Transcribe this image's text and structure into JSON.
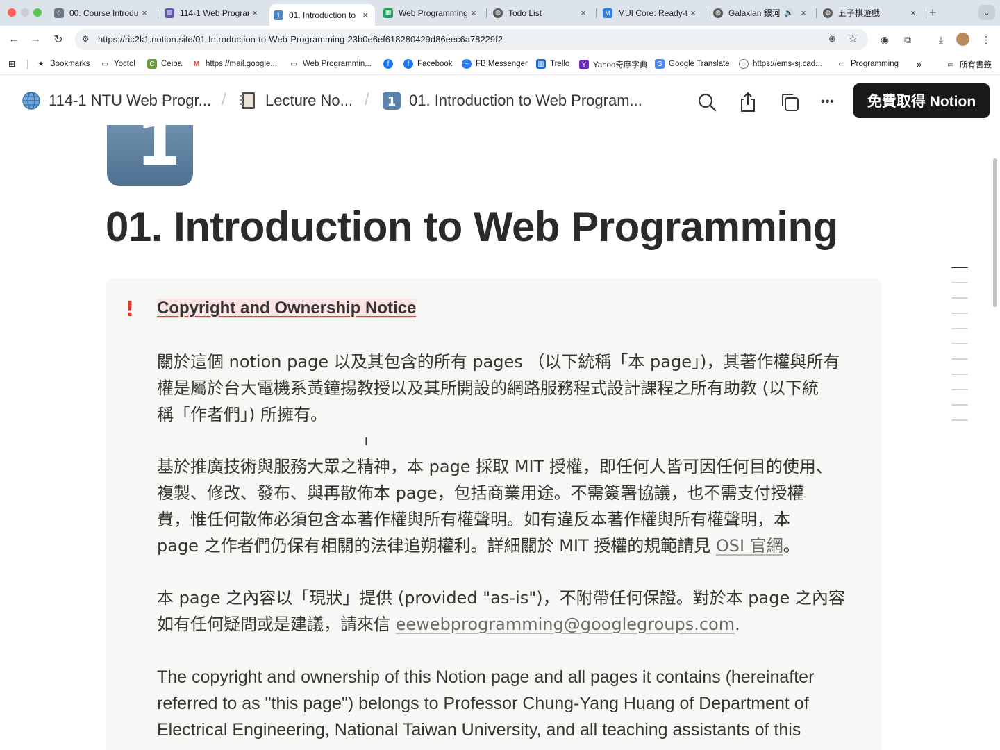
{
  "browser": {
    "tabs": [
      {
        "label": "00. Course Introdu",
        "icon": "notion-page-icon"
      },
      {
        "label": "114-1 Web Prograr",
        "icon": "notion-db-icon"
      },
      {
        "label": "01. Introduction to",
        "icon": "notion-page-icon",
        "active": true
      },
      {
        "label": "Web Programming",
        "icon": "sheets-icon"
      },
      {
        "label": "Todo List",
        "icon": "globe-icon"
      },
      {
        "label": "MUI Core: Ready-t",
        "icon": "mui-icon"
      },
      {
        "label": "Galaxian 銀河​",
        "icon": "globe-icon"
      },
      {
        "label": "五子棋遊戲",
        "icon": "globe-icon"
      }
    ],
    "new_tab": "+",
    "url": "https://ric2k1.notion.site/01-Introduction-to-Web-Programming-23b0e6ef618280429d86eec6a78229f2"
  },
  "bookmarks": [
    {
      "label": "Bookmarks",
      "icon": "star-icon"
    },
    {
      "label": "Yoctol",
      "icon": "folder-icon"
    },
    {
      "label": "Ceiba",
      "icon": "ceiba-icon"
    },
    {
      "label": "https://mail.google...",
      "icon": "gmail-icon"
    },
    {
      "label": "Web Programmin...",
      "icon": "folder-icon"
    },
    {
      "label": "",
      "icon": "facebook-icon"
    },
    {
      "label": "Facebook",
      "icon": "facebook-icon"
    },
    {
      "label": "FB Messenger",
      "icon": "messenger-icon"
    },
    {
      "label": "Trello",
      "icon": "trello-icon"
    },
    {
      "label": "Yahoo奇摩字典",
      "icon": "yahoo-icon"
    },
    {
      "label": "Google Translate",
      "icon": "translate-icon"
    },
    {
      "label": "https://ems-sj.cad...",
      "icon": "globe-icon"
    },
    {
      "label": "Programming",
      "icon": "folder-icon"
    },
    {
      "label": "所有書籤",
      "icon": "folder-icon"
    }
  ],
  "bookmarks_overflow": "»",
  "notion": {
    "breadcrumbs": [
      {
        "label": "114-1 NTU Web Progr..."
      },
      {
        "label": "Lecture No..."
      },
      {
        "label": "01. Introduction to Web Program..."
      }
    ],
    "breadcrumb_sep": "/",
    "cta_label": "免費取得 Notion",
    "more_label": "•••"
  },
  "page": {
    "icon_glyph": "1",
    "title": "01. Introduction to Web Programming",
    "callout": {
      "icon_glyph": "!",
      "heading": "Copyright and Ownership Notice",
      "p1": [
        "關於這個 notion page 以及其包含的所有 pages （以下統稱「本 page」)，其著作權與所有",
        "權是屬於台大電機系黃鐘揚教授以及其所開設的網路服務程式設計課程之所有助教 (以下統",
        "稱「作者們」) 所擁有。"
      ],
      "p2": [
        "基於推廣技術與服務大眾之精神，本 page 採取 MIT 授權，即任何人皆可因任何目的使用、",
        "複製、修改、發布、與再散佈本 page，包括商業用途。不需簽署協議，也不需支付授權",
        "費，惟任何散佈必須包含本著作權與所有權聲明。如有違反本著作權與所有權聲明，本"
      ],
      "p2_last_pre": "page 之作者們仍保有相關的法律追朔權利。詳細關於 MIT 授權的規範請見 ",
      "p2_link": "OSI 官網",
      "p2_last_post": "。",
      "p3_line1": "本 page 之內容以「現狀」提供 (provided \"as-is\")，不附帶任何保證。對於本 page 之內容",
      "p3_line2_pre": "如有任何疑問或是建議，請來信 ",
      "p3_email": "eewebprogramming@googlegroups.com",
      "p3_line2_post": ".",
      "p4": [
        "The copyright and ownership of this Notion page and all pages it contains (hereinafter",
        "referred to as \"this page\") belongs to Professor Chung-Yang Huang of Department of",
        "Electrical Engineering, National Taiwan University, and all teaching assistants of this"
      ]
    }
  },
  "colors": {
    "accent_red": "#d93a2b",
    "callout_bg": "#f7f7f5",
    "cta_bg": "#191919"
  }
}
